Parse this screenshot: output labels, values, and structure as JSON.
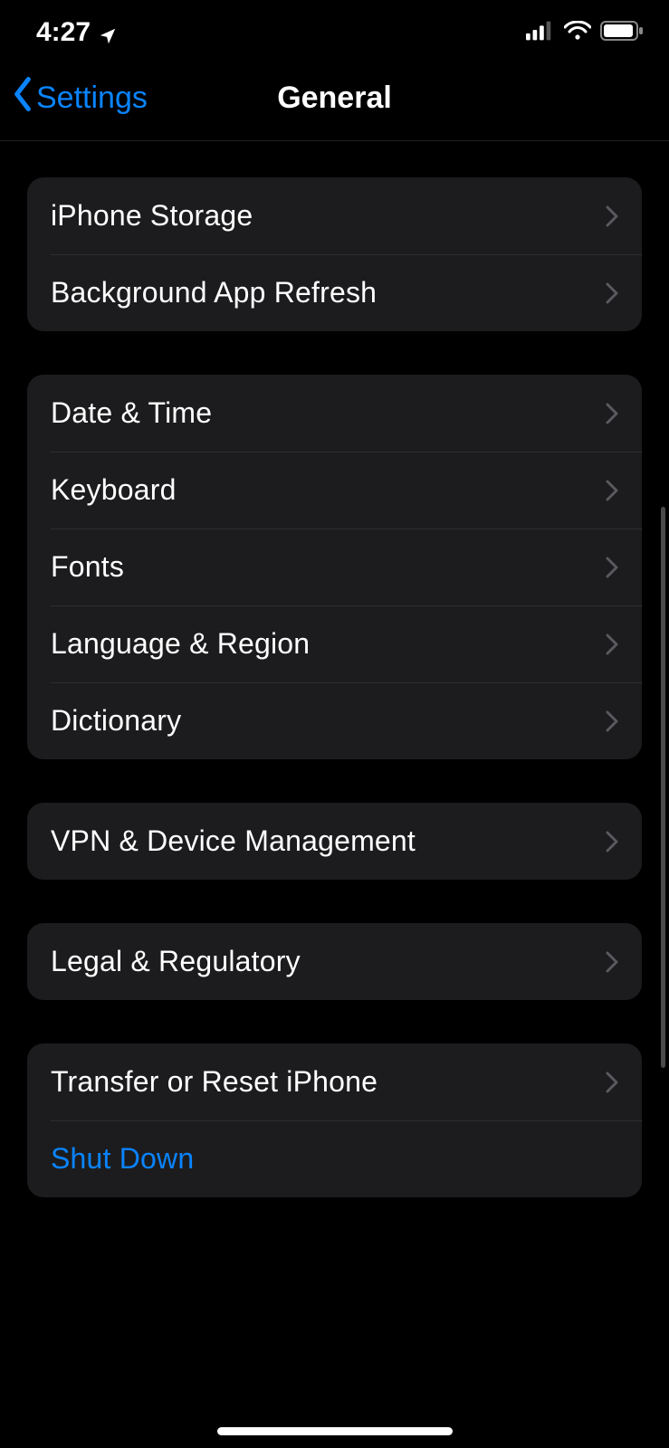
{
  "status_bar": {
    "time": "4:27"
  },
  "nav": {
    "back_label": "Settings",
    "title": "General"
  },
  "groups": [
    {
      "rows": [
        {
          "key": "iphone-storage",
          "label": "iPhone Storage",
          "chevron": true
        },
        {
          "key": "background-app-refresh",
          "label": "Background App Refresh",
          "chevron": true
        }
      ]
    },
    {
      "rows": [
        {
          "key": "date-time",
          "label": "Date & Time",
          "chevron": true
        },
        {
          "key": "keyboard",
          "label": "Keyboard",
          "chevron": true
        },
        {
          "key": "fonts",
          "label": "Fonts",
          "chevron": true
        },
        {
          "key": "language-region",
          "label": "Language & Region",
          "chevron": true
        },
        {
          "key": "dictionary",
          "label": "Dictionary",
          "chevron": true
        }
      ]
    },
    {
      "rows": [
        {
          "key": "vpn-device-management",
          "label": "VPN & Device Management",
          "chevron": true
        }
      ]
    },
    {
      "rows": [
        {
          "key": "legal-regulatory",
          "label": "Legal & Regulatory",
          "chevron": true
        }
      ]
    },
    {
      "rows": [
        {
          "key": "transfer-reset",
          "label": "Transfer or Reset iPhone",
          "chevron": true
        },
        {
          "key": "shut-down",
          "label": "Shut Down",
          "chevron": false,
          "accent": true
        }
      ]
    }
  ],
  "colors": {
    "accent": "#0a84ff",
    "group_bg": "#1c1c1e"
  }
}
